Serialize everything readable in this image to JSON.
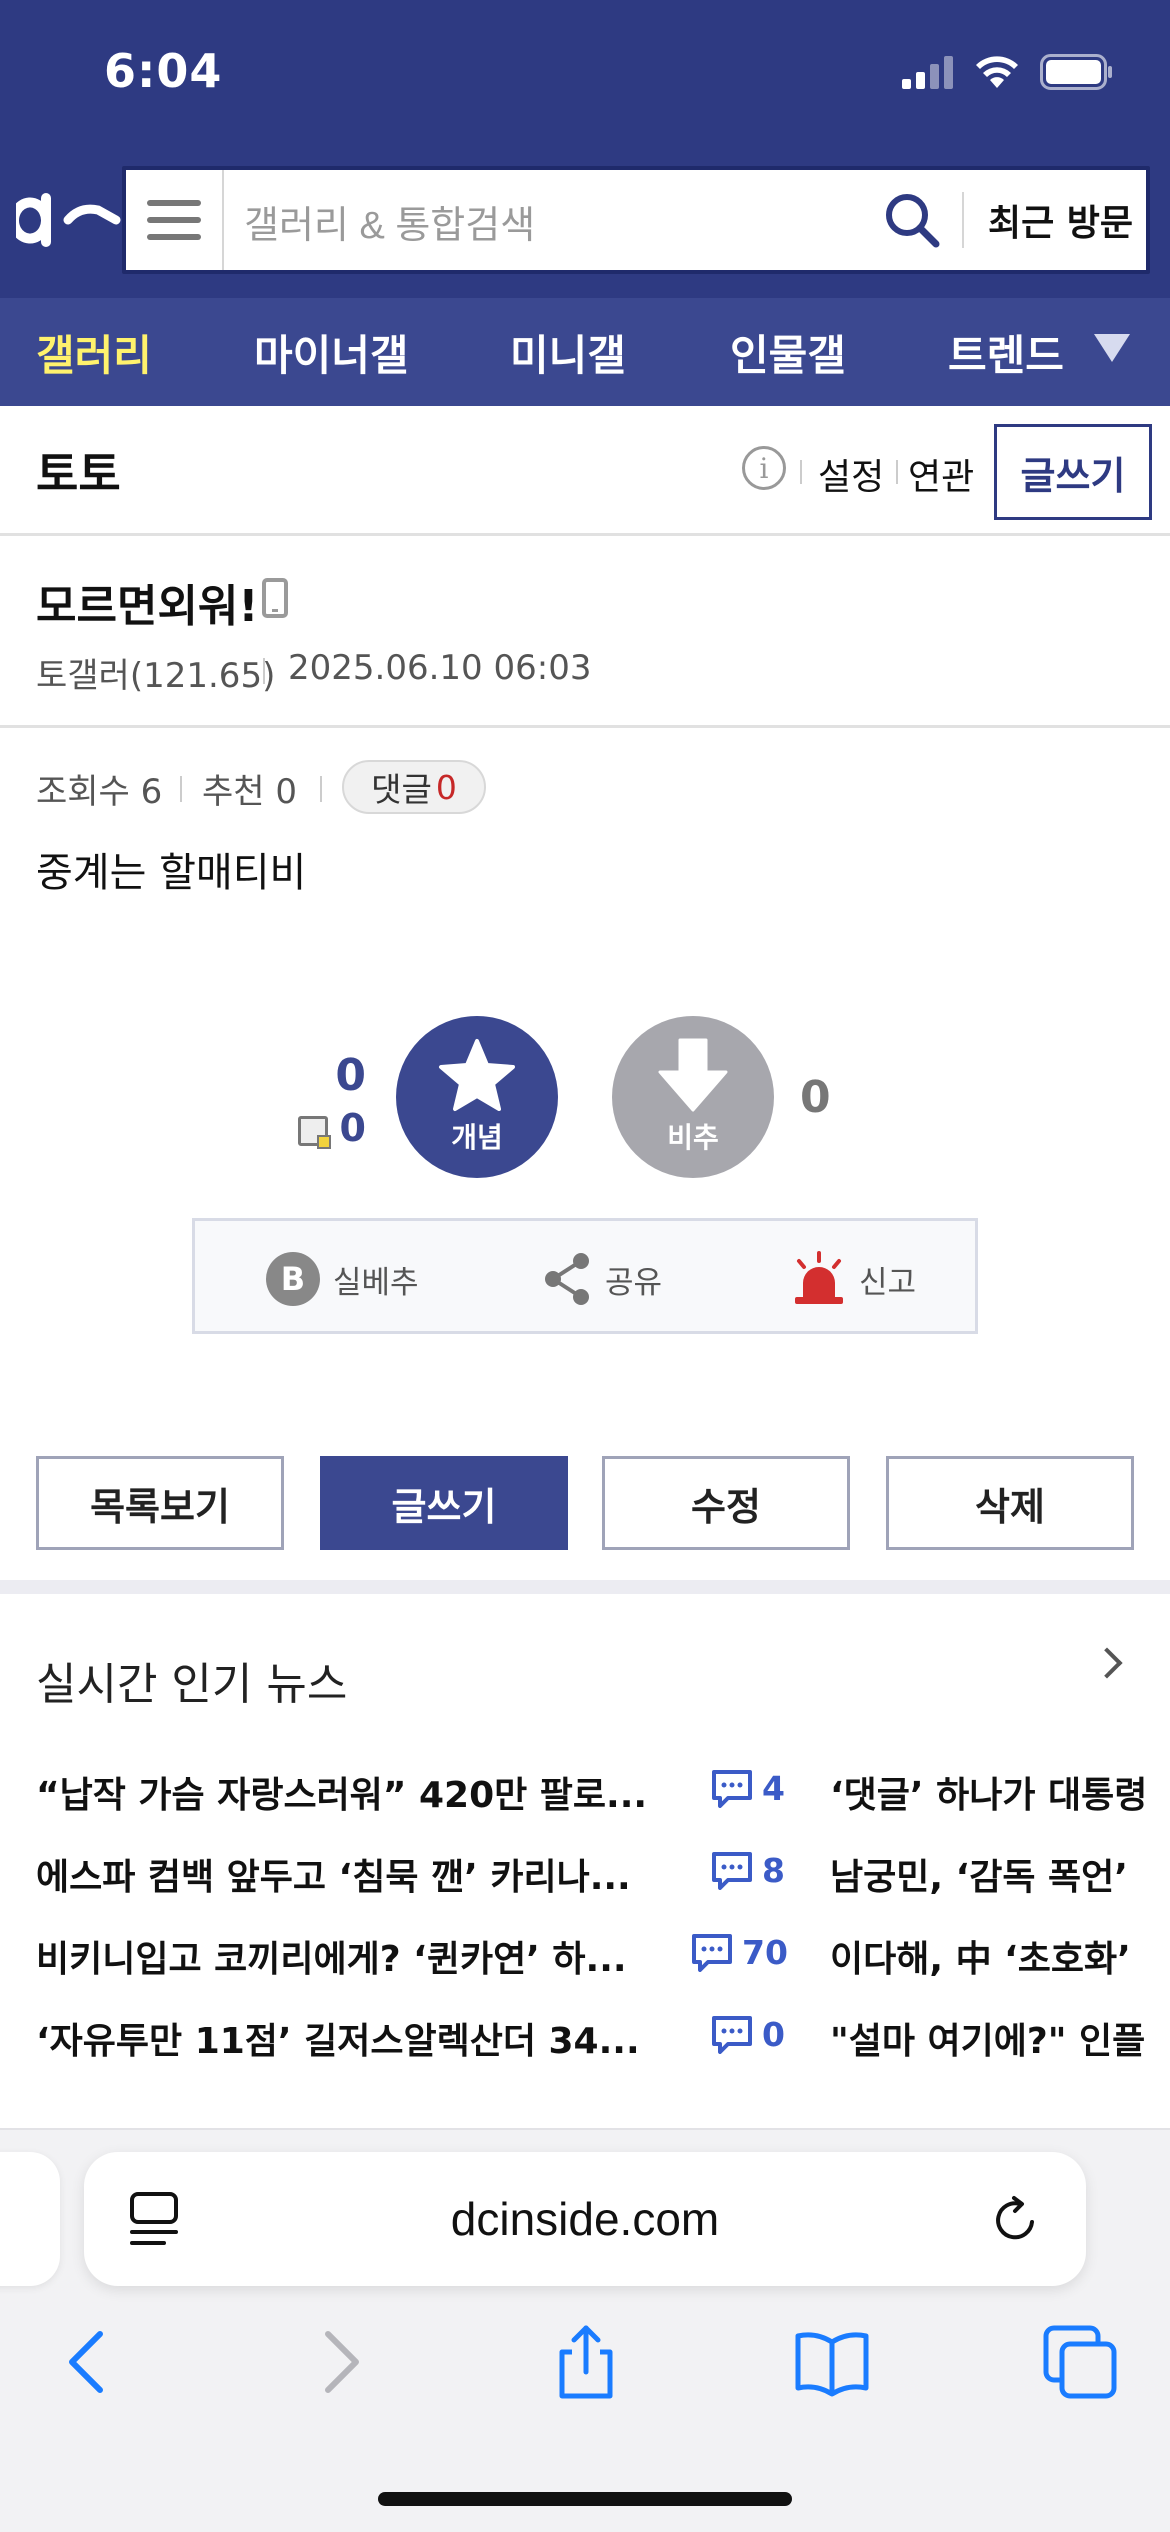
{
  "status_bar": {
    "time": "6:04"
  },
  "header": {
    "search_placeholder": "갤러리 & 통합검색",
    "recent_label": "최근 방문"
  },
  "gnb": {
    "items": [
      "갤러리",
      "마이너갤",
      "미니갤",
      "인물갤",
      "트렌드"
    ],
    "active_color": "#fff26d"
  },
  "gallery": {
    "title": "토토",
    "links": [
      "설정",
      "연관"
    ],
    "write_label": "글쓰기"
  },
  "post": {
    "title": "모르면외워!",
    "writer": "토갤러(121.65)",
    "date": "2025.06.10 06:03",
    "views_label": "조회수 6",
    "recommend_label": "추천 0",
    "reply_label": "댓글",
    "reply_count": "0",
    "body": "중계는 할매티비"
  },
  "recommend": {
    "up_count": "0",
    "fix_count": "0",
    "up_label": "개념",
    "down_label": "비추",
    "down_count": "0"
  },
  "actions": [
    {
      "label": "실베추",
      "icon": "best-b-icon"
    },
    {
      "label": "공유",
      "icon": "share-icon"
    },
    {
      "label": "신고",
      "icon": "siren-icon"
    }
  ],
  "bottom_buttons": [
    "목록보기",
    "글쓰기",
    "수정",
    "삭제"
  ],
  "news": {
    "title": "실시간 인기 뉴스",
    "items": [
      {
        "text": "“납작 가슴 자랑스러워” 420만 팔로...",
        "comments": "4",
        "right": "‘댓글’ 하나가 대통령"
      },
      {
        "text": "에스파 컴백 앞두고 ‘침묵 깬’ 카리나...",
        "comments": "8",
        "right": "남궁민, ‘감독 폭언’"
      },
      {
        "text": "비키니입고 코끼리에게? ‘퀸카연’ 하...",
        "comments": "70",
        "right": "이다해, 中 ‘초호화’"
      },
      {
        "text": "‘자유투만 11점’ 길저스알렉산더 34...",
        "comments": "0",
        "right": "\"설마 여기에?\" 인플"
      }
    ]
  },
  "browser": {
    "url": "dcinside.com"
  },
  "colors": {
    "brand": "#2e3a82",
    "accent": "#3b4890",
    "reply_red": "#c62828"
  }
}
